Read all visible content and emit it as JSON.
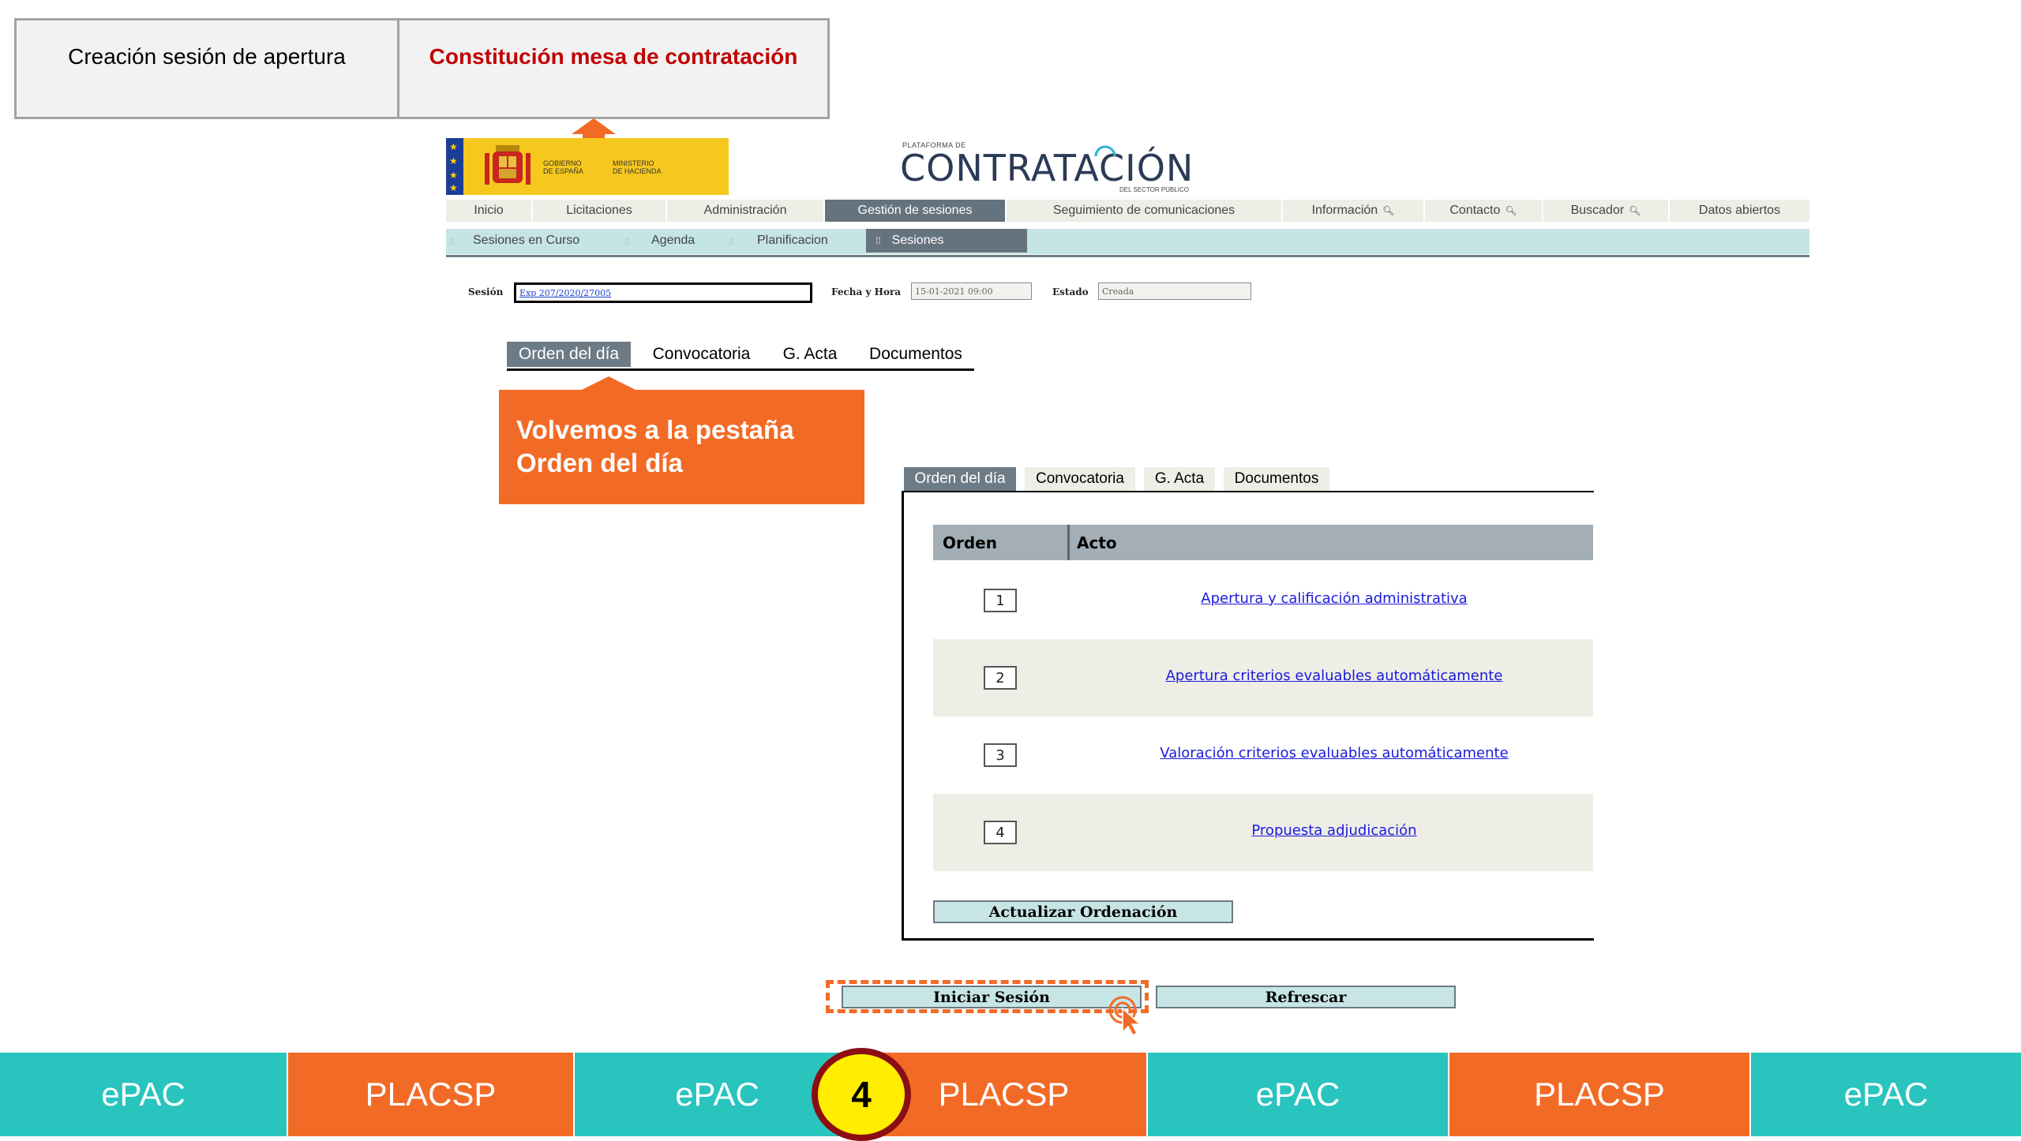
{
  "steps": {
    "previous": "Creación sesión de apertura",
    "current": "Constitución mesa de contratación"
  },
  "header": {
    "gov_line1": "GOBIERNO",
    "gov_line2": "DE ESPAÑA",
    "ministry_line1": "MINISTERIO",
    "ministry_line2": "DE HACIENDA",
    "platform_small": "PLATAFORMA DE",
    "platform_title": "CONTRATACIÓN",
    "platform_sub": "DEL SECTOR PÚBLICO"
  },
  "nav": {
    "main": [
      "Inicio",
      "Licitaciones",
      "Administración",
      "Gestión de sesiones",
      "Seguimiento de comunicaciones",
      "Información",
      "Contacto",
      "Buscador",
      "Datos abiertos"
    ],
    "sub": [
      "Sesiones en Curso",
      "Agenda",
      "Planificacion",
      "Sesiones"
    ]
  },
  "session": {
    "session_label": "Sesión",
    "session_value": "Exp 207/2020/27005",
    "date_label": "Fecha y Hora",
    "date_value": "15-01-2021 09:00",
    "state_label": "Estado",
    "state_value": "Creada"
  },
  "tabs": [
    "Orden del día",
    "Convocatoria",
    "G. Acta",
    "Documentos"
  ],
  "callout": {
    "line1": "Volvemos a la pestaña",
    "line2": "Orden del día"
  },
  "table": {
    "headers": [
      "Orden",
      "Acto"
    ],
    "rows": [
      {
        "order": "1",
        "act": "Apertura y calificación administrativa"
      },
      {
        "order": "2",
        "act": "Apertura criterios evaluables automáticamente"
      },
      {
        "order": "3",
        "act": "Valoración criterios evaluables automáticamente"
      },
      {
        "order": "4",
        "act": "Propuesta adjudicación"
      }
    ],
    "update_button": "Actualizar Ordenación"
  },
  "actions": {
    "start_session": "Iniciar Sesión",
    "refresh": "Refrescar"
  },
  "footer": {
    "segments": [
      "ePAC",
      "PLACSP",
      "ePAC",
      "PLACSP",
      "ePAC",
      "PLACSP",
      "ePAC"
    ],
    "step_number": "4"
  },
  "colors": {
    "teal": "#29c4be",
    "orange": "#f26b26",
    "active_step_text": "#c00000",
    "link": "#1a1adb",
    "selected_tab": "#6d7b86"
  }
}
